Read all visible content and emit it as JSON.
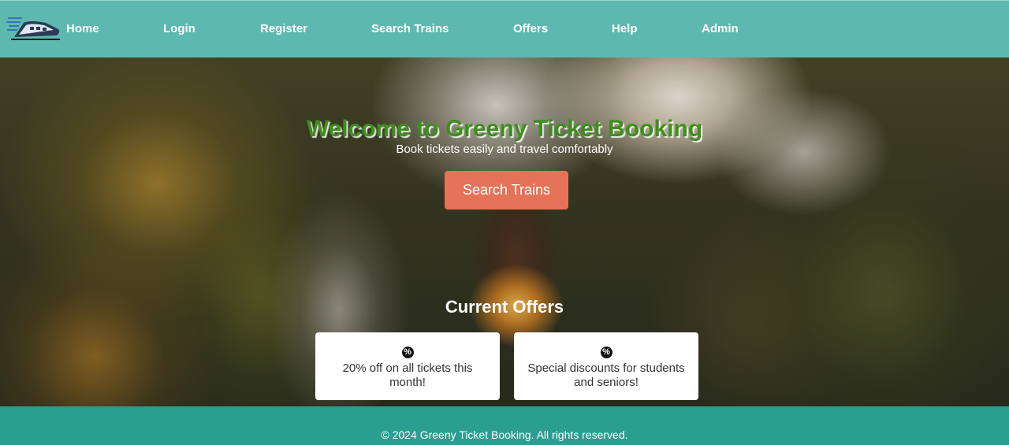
{
  "nav": {
    "logo_icon": "train-icon",
    "links": [
      {
        "label": "Home"
      },
      {
        "label": "Login"
      },
      {
        "label": "Register"
      },
      {
        "label": "Search Trains"
      },
      {
        "label": "Offers"
      },
      {
        "label": "Help"
      },
      {
        "label": "Admin"
      }
    ]
  },
  "hero": {
    "title": "Welcome to Greeny Ticket Booking",
    "subtitle": "Book tickets easily and travel comfortably",
    "search_button": "Search Trains",
    "offers_heading": "Current Offers",
    "offers": [
      {
        "icon": "percent-badge-icon",
        "text": "20% off on all tickets this month!"
      },
      {
        "icon": "percent-badge-icon",
        "text": "Special discounts for students and seniors!"
      }
    ]
  },
  "footer": {
    "text": "© 2024 Greeny Ticket Booking. All rights reserved."
  },
  "colors": {
    "navbar": "#5db9b0",
    "footer": "#2a9e90",
    "title_green": "#3e8e1e",
    "button": "#e57357"
  }
}
